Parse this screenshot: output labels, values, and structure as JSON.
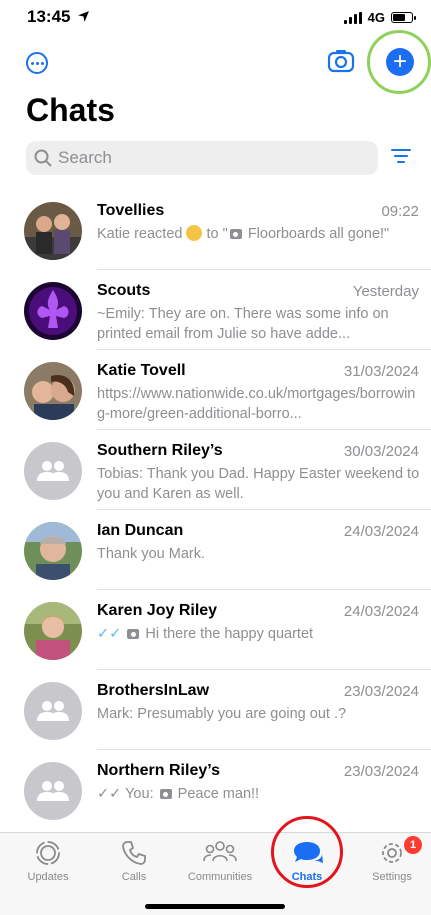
{
  "status": {
    "time": "13:45",
    "network": "4G"
  },
  "header": {
    "title": "Chats"
  },
  "search": {
    "placeholder": "Search"
  },
  "chats": [
    {
      "name": "Tovellies",
      "time": "09:22",
      "preview_prefix": "Katie reacted ",
      "preview_mid": " to \"",
      "preview_text": " Floorboards all gone!\""
    },
    {
      "name": "Scouts",
      "time": "Yesterday",
      "preview": "~Emily: They are on. There was some info on printed email from Julie so have adde..."
    },
    {
      "name": "Katie Tovell",
      "time": "31/03/2024",
      "preview": "https://www.nationwide.co.uk/mortgages/borrowing-more/green-additional-borro..."
    },
    {
      "name": "Southern Riley’s",
      "time": "30/03/2024",
      "preview": "Tobias: Thank you Dad. Happy Easter weekend to you and Karen as well."
    },
    {
      "name": "Ian Duncan",
      "time": "24/03/2024",
      "preview": "Thank you Mark."
    },
    {
      "name": "Karen Joy Riley",
      "time": "24/03/2024",
      "preview_text": " Hi there the happy quartet"
    },
    {
      "name": "BrothersInLaw",
      "time": "23/03/2024",
      "preview": "Mark: Presumably you are going out .?"
    },
    {
      "name": "Northern Riley’s",
      "time": "23/03/2024",
      "preview_prefix": "You: ",
      "preview_text": " Peace man!!"
    }
  ],
  "tabs": {
    "updates": "Updates",
    "calls": "Calls",
    "communities": "Communities",
    "chats": "Chats",
    "settings": "Settings"
  },
  "settings_badge": "1",
  "colors": {
    "accent": "#1b6ef3",
    "read_tick": "#53bdeb",
    "badge": "#ff3b30"
  }
}
